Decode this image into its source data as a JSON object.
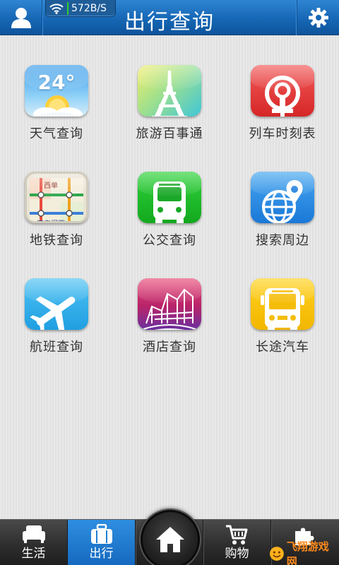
{
  "header": {
    "title": "出行查询",
    "status_speed": "572B/S",
    "left_icon": "user-icon",
    "right_icon": "gear-icon"
  },
  "tiles": [
    {
      "label": "天气查询",
      "icon": "weather-icon",
      "temp": "24°"
    },
    {
      "label": "旅游百事通",
      "icon": "eiffel-tower-icon"
    },
    {
      "label": "列车时刻表",
      "icon": "railway-icon"
    },
    {
      "label": "地铁查询",
      "icon": "subway-map-icon",
      "map_text_top": "西单",
      "map_text_bottom": "天安门西"
    },
    {
      "label": "公交查询",
      "icon": "bus-icon"
    },
    {
      "label": "搜索周边",
      "icon": "globe-pin-icon"
    },
    {
      "label": "航班查询",
      "icon": "airplane-icon"
    },
    {
      "label": "酒店查询",
      "icon": "hotel-building-icon"
    },
    {
      "label": "长途汽车",
      "icon": "coach-bus-icon"
    }
  ],
  "bottom_nav": {
    "items": [
      {
        "label": "生活",
        "icon": "sofa-icon"
      },
      {
        "label": "出行",
        "icon": "briefcase-icon",
        "active": true
      },
      {
        "label": "",
        "icon": "home-icon"
      },
      {
        "label": "购物",
        "icon": "cart-icon"
      },
      {
        "label": "",
        "icon": "puzzle-icon"
      }
    ]
  },
  "watermark": {
    "text": "飞翔游戏网"
  },
  "colors": {
    "header": "#1667b5",
    "active_tab": "#2f8ee0",
    "nav_bg": "#2c2c2c"
  }
}
